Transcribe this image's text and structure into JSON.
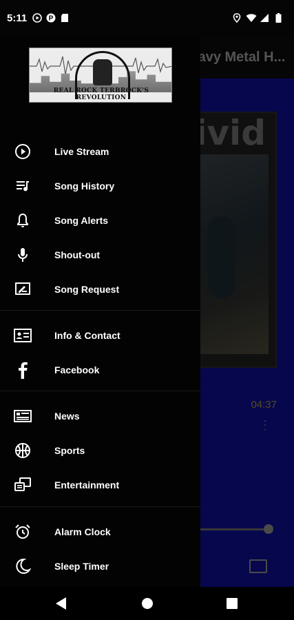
{
  "status_bar": {
    "time": "5:11",
    "left_icons": [
      "play-circle-icon",
      "pinterest-icon",
      "sd-card-icon"
    ],
    "right_icons": [
      "location-icon",
      "wifi-icon",
      "signal-icon",
      "battery-icon"
    ]
  },
  "background_app": {
    "toolbar_title": "Heavy Metal H...",
    "album_art_text": "vivid",
    "duration": "04:37",
    "accent_color": "#0e0e8e"
  },
  "drawer": {
    "logo_caption": "REAL ROCK TERBROCK'S REVOLUTION",
    "items": [
      {
        "label": "Live Stream",
        "icon": "play-circle-icon"
      },
      {
        "label": "Song History",
        "icon": "playlist-icon"
      },
      {
        "label": "Song Alerts",
        "icon": "bell-icon"
      },
      {
        "label": "Shout-out",
        "icon": "microphone-icon"
      },
      {
        "label": "Song Request",
        "icon": "request-icon"
      },
      {
        "label": "Info & Contact",
        "icon": "contact-card-icon"
      },
      {
        "label": "Facebook",
        "icon": "facebook-icon"
      },
      {
        "label": "News",
        "icon": "news-icon"
      },
      {
        "label": "Sports",
        "icon": "basketball-icon"
      },
      {
        "label": "Entertainment",
        "icon": "entertainment-icon"
      },
      {
        "label": "Alarm Clock",
        "icon": "alarm-clock-icon"
      },
      {
        "label": "Sleep Timer",
        "icon": "moon-icon"
      }
    ]
  },
  "navbar": {
    "buttons": [
      "back-icon",
      "home-icon",
      "recents-icon"
    ]
  }
}
